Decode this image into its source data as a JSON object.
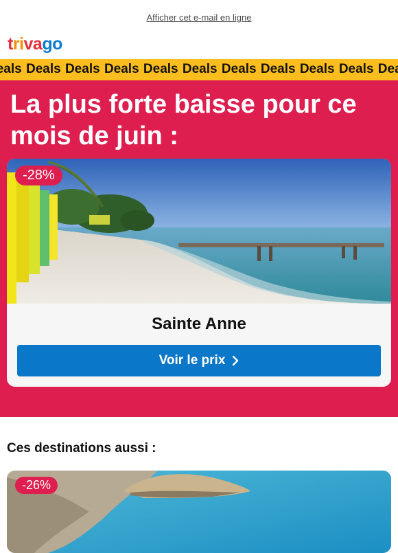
{
  "header": {
    "view_online_label": "Afficher cet e-mail en ligne",
    "logo": {
      "t": "t",
      "ri": "ri",
      "va": "va",
      "go": "go"
    }
  },
  "deals_strip": {
    "text": "Deals Deals Deals Deals Deals Deals Deals Deals Deals Deals Deals",
    "background": "#fcbd1f"
  },
  "hero": {
    "title": "La plus forte baisse pour ce mois de juin :",
    "background": "#dd1e4f",
    "card": {
      "discount": "-28%",
      "destination": "Sainte Anne",
      "cta_label": "Voir le prix",
      "cta_icon": "chevron-right-icon",
      "cta_color": "#0a77c9"
    }
  },
  "more": {
    "title": "Ces destinations aussi :",
    "cards": [
      {
        "discount": "-26%"
      }
    ]
  }
}
